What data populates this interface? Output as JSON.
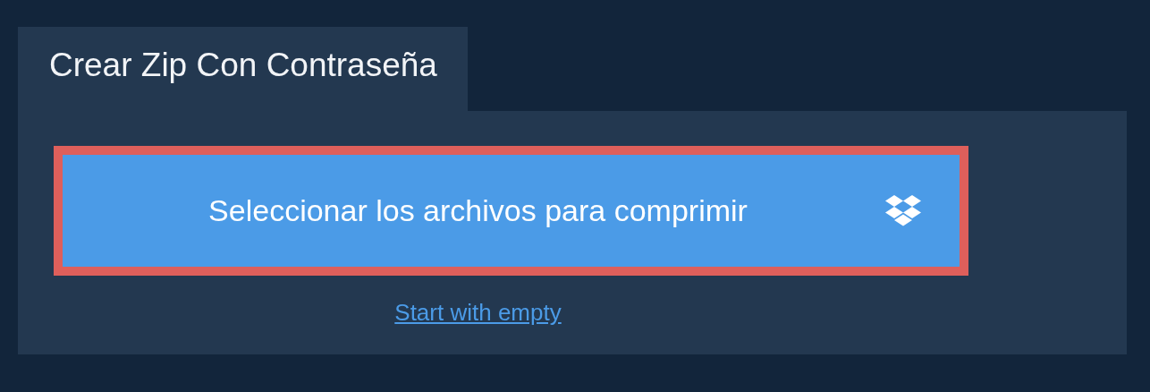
{
  "tab": {
    "title": "Crear Zip Con Contraseña"
  },
  "select_button": {
    "label": "Seleccionar los archivos para comprimir"
  },
  "link": {
    "label": "Start with empty"
  }
}
